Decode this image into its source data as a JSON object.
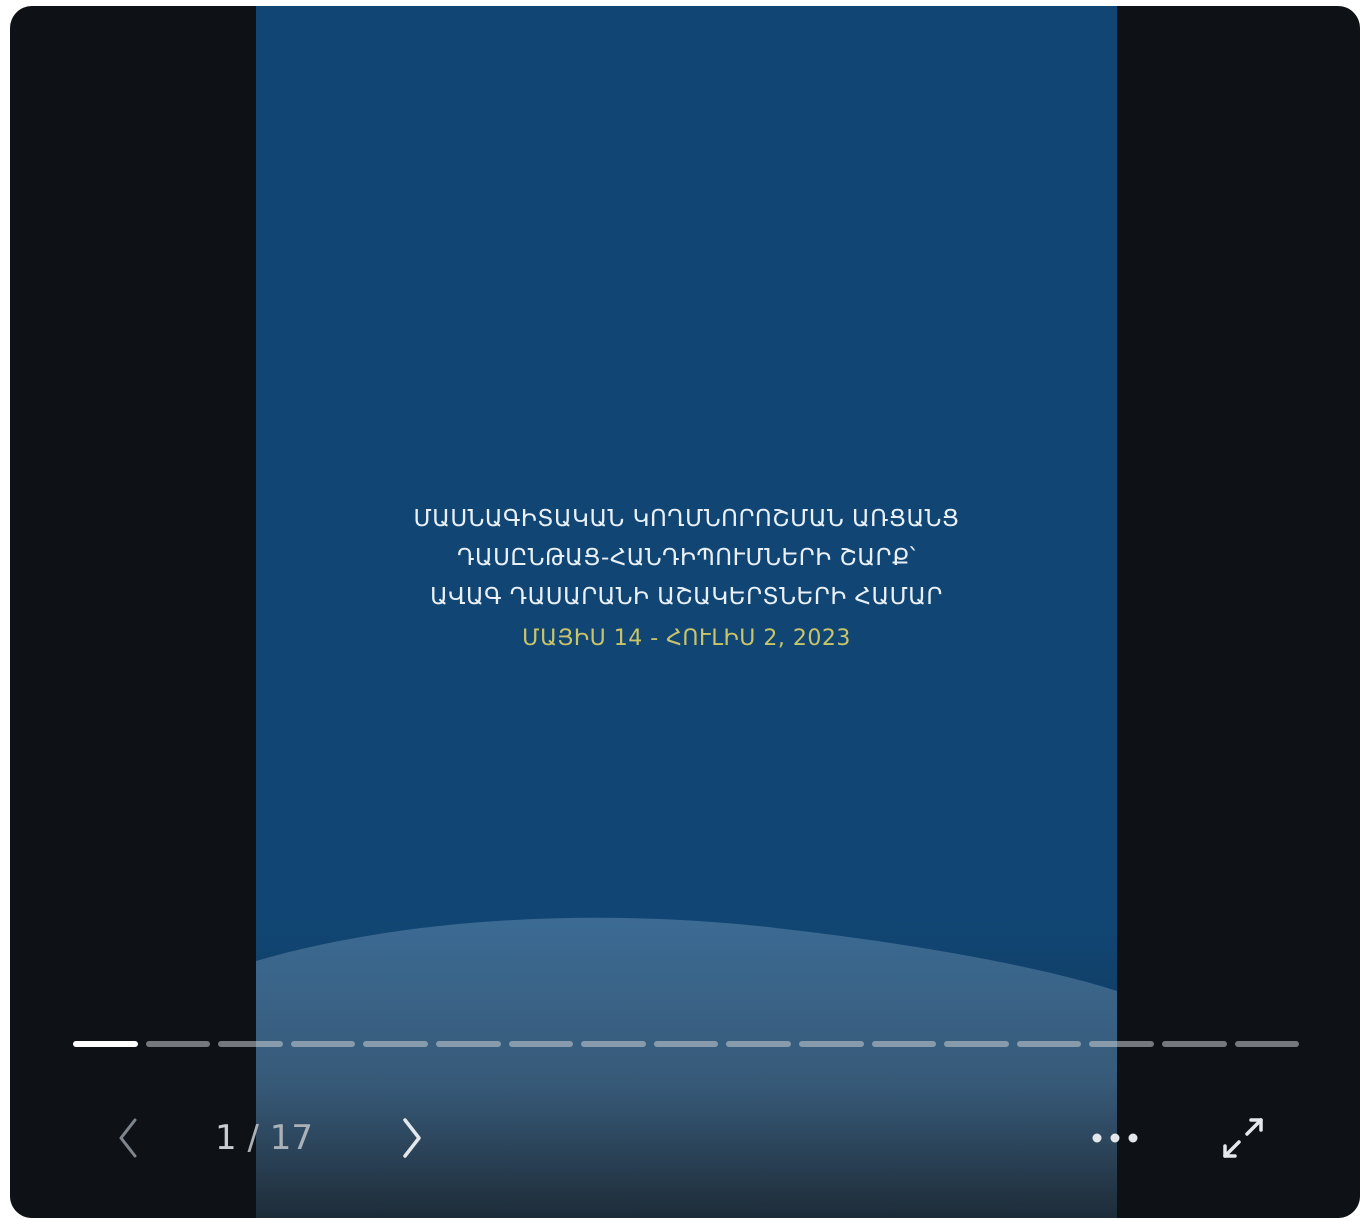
{
  "slide": {
    "title_lines": [
      "ՄԱՍՆԱԳԻՏԱԿԱՆ ԿՈՂՄՆՈՐՈՇՄԱՆ ԱՌՑԱՆՑ",
      "ԴԱՍԸՆԹԱՑ-ՀԱՆԴԻՊՈՒՄՆԵՐԻ ՇԱՐՔ՝",
      "ԱՎԱԳ ԴԱՍԱՐԱՆԻ ԱՇԱԿԵՐՏՆԵՐԻ ՀԱՄԱՐ"
    ],
    "date": "ՄԱՅԻՍ 14 - ՀՈՒԼԻՍ 2, 2023",
    "background_color": "#114674",
    "date_color": "#c9c46a"
  },
  "viewer": {
    "current_page": "1",
    "separator": " / ",
    "total_pages": "17",
    "page_count": 17,
    "current_index": 1,
    "icons": {
      "previous": "chevron-left-icon",
      "next": "chevron-right-icon",
      "more": "more-horizontal-icon",
      "expand": "expand-icon"
    }
  }
}
